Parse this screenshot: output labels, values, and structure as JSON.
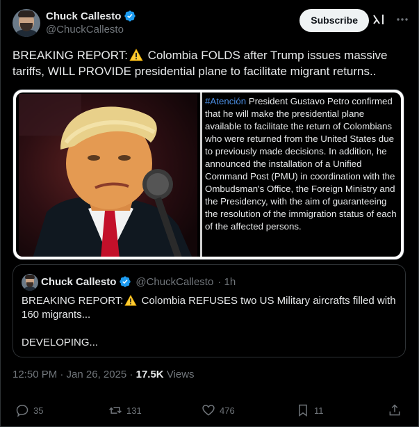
{
  "author": {
    "display_name": "Chuck Callesto",
    "handle": "@ChuckCallesto",
    "verified": true
  },
  "header": {
    "subscribe_label": "Subscribe",
    "icons": [
      "grok-icon",
      "more-icon"
    ]
  },
  "tweet": {
    "text_before": "BREAKING REPORT:",
    "text_after": " Colombia FOLDS after Trump issues massive tariffs, WILL PROVIDE presidential plane to facilitate migrant returns.."
  },
  "media": {
    "hashtag": "#Atención",
    "statement": " President Gustavo Petro confirmed that he will make the presidential plane available to facilitate the return of Colombians who were returned from the United States due to previously made decisions. In addition, he announced the installation of a Unified Command Post (PMU) in coordination with the Ombudsman's Office, the Foreign Ministry and the Presidency, with the aim of guaranteeing the resolution of the immigration status of each of the affected persons."
  },
  "quoted_tweet": {
    "display_name": "Chuck Callesto",
    "handle": "@ChuckCallesto",
    "time": "· 1h",
    "line1_before": "BREAKING REPORT:",
    "line1_after": " Colombia REFUSES two US Military aircrafts filled with 160 migrants...",
    "line2": "DEVELOPING..."
  },
  "meta": {
    "timestamp": "12:50 PM · Jan 26, 2025 ·",
    "views_count": "17.5K",
    "views_label": "Views"
  },
  "actions": {
    "replies": "35",
    "reposts": "131",
    "likes": "476",
    "bookmarks": "11"
  },
  "colors": {
    "background": "#000000",
    "text": "#e7e9ea",
    "muted": "#71767b",
    "verified_blue": "#1d9bf0",
    "hashtag_blue": "#4a8de0"
  }
}
